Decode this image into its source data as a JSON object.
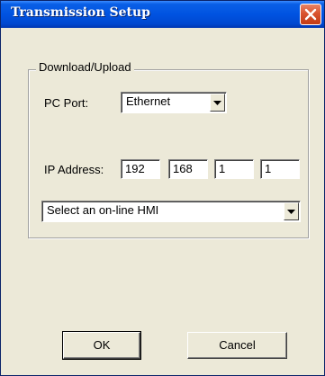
{
  "window": {
    "title": "Transmission Setup",
    "close_icon": "close-icon"
  },
  "group": {
    "label": "Download/Upload"
  },
  "pc_port": {
    "label": "PC Port:",
    "selected": "Ethernet"
  },
  "ip_address": {
    "label": "IP Address:",
    "octets": [
      "192",
      "168",
      "1",
      "1"
    ]
  },
  "hmi_select": {
    "selected": "Select an on-line HMI"
  },
  "buttons": {
    "ok": "OK",
    "cancel": "Cancel"
  },
  "colors": {
    "titlebar": "#0053e1",
    "dialog_bg": "#ece9d8",
    "close_button": "#d9532e"
  }
}
